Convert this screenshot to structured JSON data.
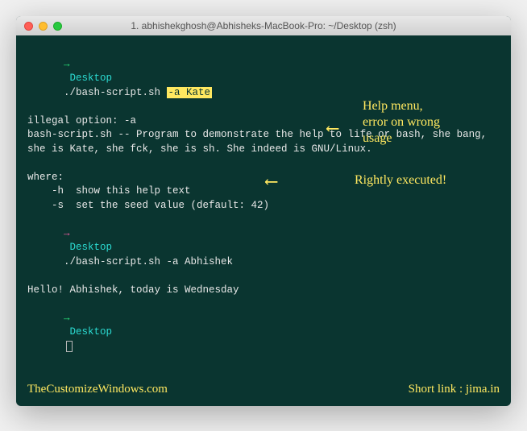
{
  "window": {
    "title": "1. abhishekghosh@Abhisheks-MacBook-Pro: ~/Desktop (zsh)"
  },
  "lines": {
    "prompt1_arrow": "→",
    "prompt1_dir": "Desktop",
    "prompt1_cmd": "./bash-script.sh ",
    "prompt1_hl": "-a Kate",
    "error": "illegal option: -a",
    "desc": "bash-script.sh -- Program to demonstrate the help to life or bash, she bang, she is Kate, she fck, she is sh. She indeed is GNU/Linux.",
    "where": "where:",
    "opt_h": "    -h  show this help text",
    "opt_s": "    -s  set the seed value (default: 42)",
    "prompt2_arrow": "→",
    "prompt2_dir": "Desktop",
    "prompt2_cmd": "./bash-script.sh -a Abhishek",
    "output": "Hello! Abhishek, today is Wednesday",
    "prompt3_arrow": "→",
    "prompt3_dir": "Desktop"
  },
  "annotations": {
    "help_text": "Help menu,\nerror on wrong\nusage",
    "rightly": "Rightly executed!",
    "arrow_sym": "⟵"
  },
  "footer": {
    "left": "TheCustomizeWindows.com",
    "right": "Short link : jima.in"
  }
}
